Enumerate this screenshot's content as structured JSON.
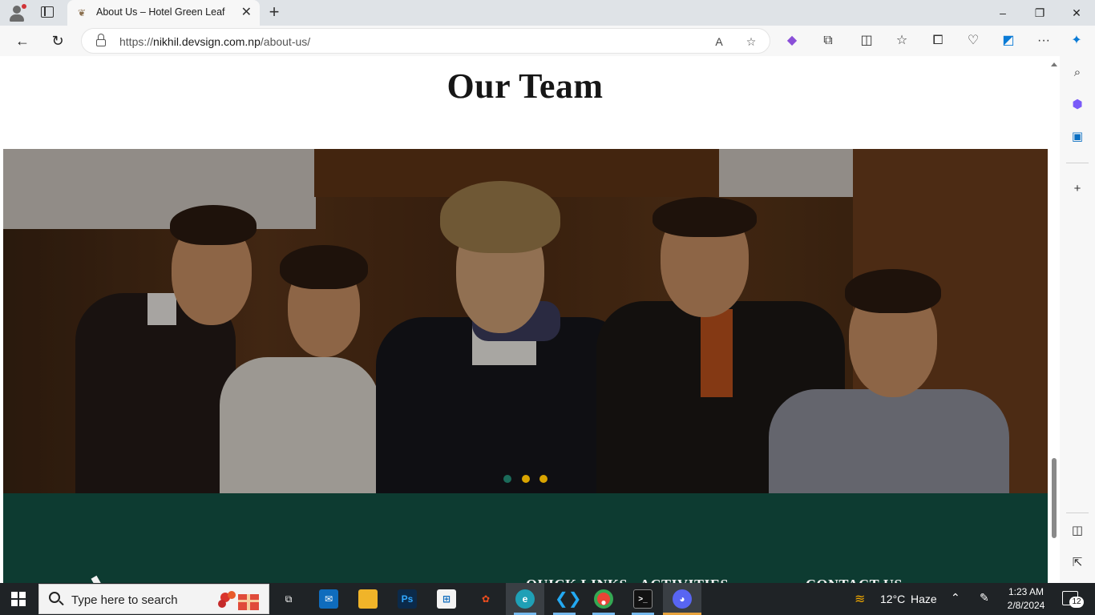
{
  "browser": {
    "tab_title": "About Us – Hotel Green Leaf",
    "tab_close": "✕",
    "new_tab": "+",
    "url_prefix": "https://",
    "url_host": "nikhil.devsign.com.np",
    "url_path": "/about-us/",
    "window_controls": [
      "–",
      "❐",
      "✕"
    ]
  },
  "page": {
    "title": "Our Team",
    "carousel": {
      "slide_count": 3,
      "active_index": 0
    },
    "footer": {
      "headings": [
        "QUICK LINKS",
        "ACTIVITIES",
        "CONTACT US"
      ]
    }
  },
  "taskbar": {
    "search_placeholder": "Type here to search",
    "weather_temp": "12°C",
    "weather_text": "Haze",
    "time": "1:23 AM",
    "date": "2/8/2024",
    "notification_count": "12",
    "apps": [
      "task-view",
      "mail",
      "file-explorer",
      "photoshop",
      "microsoft-store",
      "figma",
      "edge",
      "vs-code",
      "chrome",
      "terminal",
      "discord"
    ],
    "discord_badge": "3"
  },
  "colors": {
    "footer_bg": "#0d3b31",
    "dot_inactive": "#d9a400",
    "dot_active": "#1b6b5a",
    "taskbar_bg": "#1f2326"
  }
}
